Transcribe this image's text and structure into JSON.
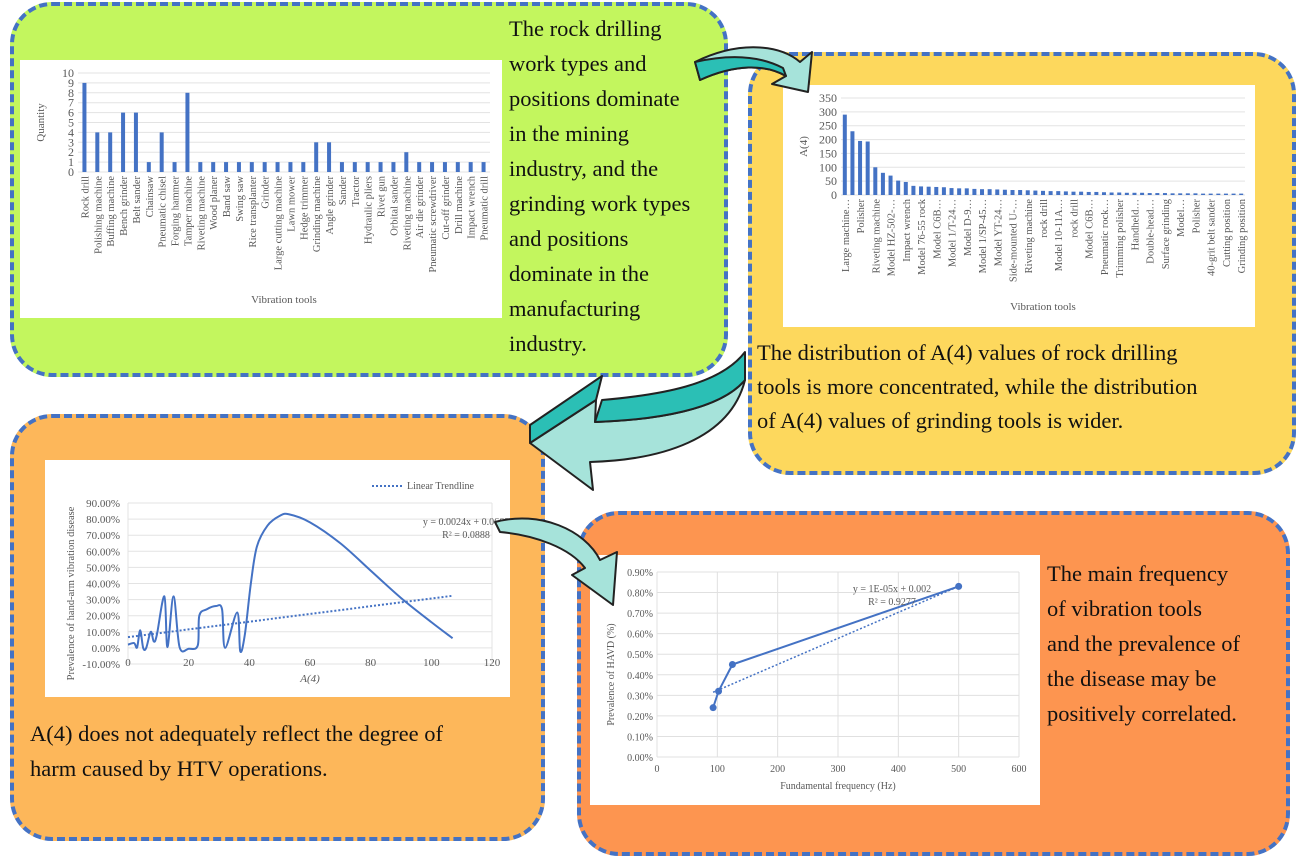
{
  "colors": {
    "box1": "#c3f65e",
    "box2": "#fdd85d",
    "box3": "#fdb75a",
    "box4": "#fd9550",
    "border": "#4472c4",
    "series": "#4472c4",
    "arrow": "#a6e3da",
    "arrow_dark": "#2bbfb5"
  },
  "box1": {
    "text_lines": [
      "The rock drilling",
      "work types and",
      "positions dominate",
      "in the mining",
      "industry, and the",
      "grinding work types",
      "and positions",
      "dominate in the",
      "manufacturing",
      "industry."
    ]
  },
  "box2": {
    "text_lines": [
      "The distribution of A(4) values of rock drilling",
      "tools is more concentrated, while the distribution",
      "of A(4) values of grinding tools is wider."
    ]
  },
  "box3": {
    "text_lines": [
      "A(4) does not adequately reflect the degree of",
      "harm caused by HTV operations."
    ]
  },
  "box4": {
    "text_lines": [
      "The main frequency",
      "of vibration tools",
      "and the prevalence of",
      "the disease may be",
      "positively correlated."
    ]
  },
  "chart_data": [
    {
      "type": "bar",
      "xlabel": "Vibration tools",
      "ylabel": "Quantity",
      "ylim": [
        0,
        10
      ],
      "yticks": [
        "0",
        "1",
        "2",
        "3",
        "4",
        "5",
        "6",
        "7",
        "8",
        "9",
        "10"
      ],
      "grid": true,
      "categories": [
        "Rock drill",
        "Polishing machine",
        "Buffing machine",
        "Bench grinder",
        "Belt sander",
        "Chainsaw",
        "Pneumatic chisel",
        "Forging hammer",
        "Tamper machine",
        "Riveting machine",
        "Wood planer",
        "Band saw",
        "Swing saw",
        "Rice transplanter",
        "Grinder",
        "Large cutting machine",
        "Lawn mower",
        "Hedge trimmer",
        "Grinding machine",
        "Angle grinder",
        "Sander",
        "Tractor",
        "Hydraulic pliers",
        "Rivet gun",
        "Orbital sander",
        "Riveting machine",
        "Air die grinder",
        "Pneumatic screwdriver",
        "Cut-off grinder",
        "Drill machine",
        "Impact wrench",
        "Pneumatic drill"
      ],
      "values": [
        9,
        4,
        4,
        6,
        6,
        1,
        4,
        1,
        8,
        1,
        1,
        1,
        1,
        1,
        1,
        1,
        1,
        1,
        3,
        3,
        1,
        1,
        1,
        1,
        1,
        2,
        1,
        1,
        1,
        1,
        1,
        1
      ]
    },
    {
      "type": "bar",
      "xlabel": "Vibration tools",
      "ylabel": "A(4)",
      "ylim": [
        0,
        350
      ],
      "yticks": [
        "0",
        "50",
        "100",
        "150",
        "200",
        "250",
        "300",
        "350"
      ],
      "grid": true,
      "category_labels": [
        "Large machine…",
        "Polisher",
        "Riveting machine",
        "Model HZ-502-…",
        "Impact wrench",
        "Model 76-55 rock",
        "Model C6B…",
        "Model 1/T-24…",
        "Model D-9…",
        "Model 1/SP-45…",
        "Model YT-24…",
        "Side-mounted U-…",
        "Riveting machine",
        "rock drill",
        "Model 10-11A…",
        "rock drill",
        "Model C6B…",
        "Pneumatic rock…",
        "Trimming polisher",
        "Handheld…",
        "Double-head…",
        "Surface grinding",
        "Model…",
        "Polisher",
        "40-grit belt sander",
        "Cutting position",
        "Grinding position"
      ],
      "values": [
        290,
        230,
        195,
        193,
        100,
        80,
        70,
        52,
        47,
        33,
        31,
        30,
        29,
        28,
        25,
        24,
        24,
        22,
        21,
        21,
        20,
        19,
        18,
        18,
        17,
        16,
        15,
        14,
        14,
        13,
        12,
        12,
        11,
        11,
        10,
        9,
        9,
        8,
        8,
        8,
        7,
        7,
        7,
        6,
        6,
        6,
        6,
        5,
        5,
        5,
        5,
        5,
        5
      ]
    },
    {
      "type": "line",
      "xlabel": "A(4)",
      "ylabel": "Prevalence of hand-arm vibration disease",
      "xlim": [
        0,
        120
      ],
      "ylim": [
        -10,
        90
      ],
      "xticks": [
        "0",
        "20",
        "40",
        "60",
        "80",
        "100",
        "120"
      ],
      "yticks": [
        "-10.00%",
        "0.00%",
        "10.00%",
        "20.00%",
        "30.00%",
        "40.00%",
        "50.00%",
        "60.00%",
        "70.00%",
        "80.00%",
        "90.00%"
      ],
      "legend": "Linear Trendline",
      "legend_position": "top-right",
      "equation": "y = 0.0024x + 0.0669",
      "r2": "R² = 0.0888",
      "trendline": {
        "slope": 0.24,
        "intercept": 6.69,
        "x": [
          0,
          107
        ]
      },
      "points": [
        [
          0,
          2
        ],
        [
          2,
          3
        ],
        [
          3,
          0.3
        ],
        [
          4,
          11
        ],
        [
          5,
          0
        ],
        [
          6,
          0
        ],
        [
          7.5,
          10
        ],
        [
          8.5,
          4
        ],
        [
          9.5,
          8
        ],
        [
          12,
          32
        ],
        [
          13,
          0.5
        ],
        [
          15,
          32
        ],
        [
          17,
          0.5
        ],
        [
          20,
          -0.5
        ],
        [
          23,
          1.5
        ],
        [
          23.5,
          20
        ],
        [
          26,
          24
        ],
        [
          29,
          26
        ],
        [
          31,
          24
        ],
        [
          32,
          0
        ],
        [
          36,
          22
        ],
        [
          37,
          -2
        ],
        [
          38.5,
          8
        ],
        [
          40.5,
          40
        ],
        [
          42.5,
          63
        ],
        [
          46,
          76
        ],
        [
          50,
          82
        ],
        [
          53,
          83
        ],
        [
          60,
          78
        ],
        [
          70,
          65
        ],
        [
          80,
          48
        ],
        [
          90,
          31
        ],
        [
          100,
          16
        ],
        [
          107,
          6
        ]
      ]
    },
    {
      "type": "scatter",
      "xlabel": "Fundamental frequency (Hz)",
      "ylabel": "Prevalence of HAVD (%)",
      "xlim": [
        0,
        600
      ],
      "ylim": [
        0,
        0.9
      ],
      "xticks": [
        "0",
        "100",
        "200",
        "300",
        "400",
        "500",
        "600"
      ],
      "yticks": [
        "0.00%",
        "0.10%",
        "0.20%",
        "0.30%",
        "0.40%",
        "0.50%",
        "0.60%",
        "0.70%",
        "0.80%",
        "0.90%"
      ],
      "equation": "y = 1E-05x + 0.002",
      "r2": "R² = 0.9277",
      "trendline": {
        "x": [
          93,
          500
        ],
        "y": [
          0.315,
          0.83
        ]
      },
      "points": [
        [
          93,
          0.24
        ],
        [
          102,
          0.32
        ],
        [
          125,
          0.45
        ],
        [
          500,
          0.83
        ]
      ]
    }
  ]
}
